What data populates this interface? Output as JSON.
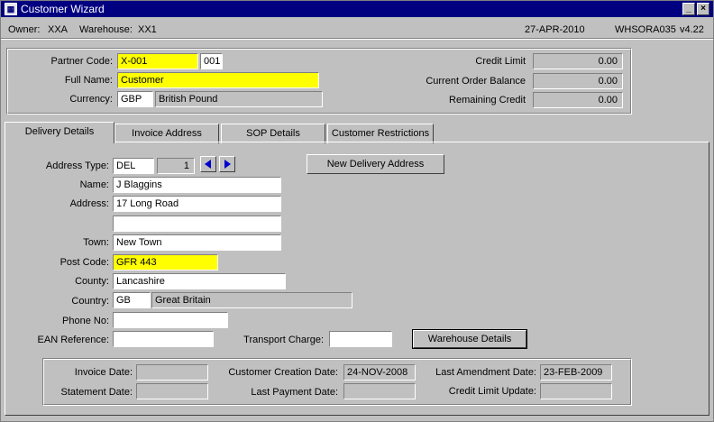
{
  "window": {
    "title": "Customer Wizard",
    "icon": "app-window-icon",
    "minimize_label": "_",
    "close_label": "×"
  },
  "status": {
    "owner_label": "Owner:",
    "owner": "XXA",
    "warehouse_label": "Warehouse:",
    "warehouse": "XX1",
    "date": "27-APR-2010",
    "form_id": "WHSORA035",
    "version": "v4.22"
  },
  "header": {
    "partner_code_label": "Partner Code:",
    "partner_code": "X-001",
    "partner_suffix": "001",
    "full_name_label": "Full Name:",
    "full_name": "Customer",
    "currency_label": "Currency:",
    "currency_code": "GBP",
    "currency_name": "British Pound",
    "credit_limit_label": "Credit Limit",
    "credit_limit": "0.00",
    "current_order_balance_label": "Current Order Balance",
    "current_order_balance": "0.00",
    "remaining_credit_label": "Remaining Credit",
    "remaining_credit": "0.00"
  },
  "tabs": [
    "Delivery Details",
    "Invoice Address",
    "SOP Details",
    "Customer Restrictions"
  ],
  "delivery": {
    "address_type_label": "Address Type:",
    "address_type": "DEL",
    "address_seq": "1",
    "new_delivery_address_button": "New Delivery Address",
    "name_label": "Name:",
    "name": "J Blaggins",
    "address_label": "Address:",
    "address_line1": "17 Long Road",
    "address_line2": "",
    "town_label": "Town:",
    "town": "New Town",
    "post_code_label": "Post Code:",
    "post_code": "GFR 443",
    "county_label": "County:",
    "county": "Lancashire",
    "country_label": "Country:",
    "country_code": "GB",
    "country_name": "Great Britain",
    "phone_label": "Phone No:",
    "phone": "",
    "ean_label": "EAN Reference:",
    "ean": "",
    "transport_charge_label": "Transport Charge:",
    "transport_charge": "",
    "warehouse_details_button": "Warehouse Details"
  },
  "dates": {
    "invoice_date_label": "Invoice Date:",
    "invoice_date": "",
    "statement_date_label": "Statement Date:",
    "statement_date": "",
    "customer_creation_date_label": "Customer Creation Date:",
    "customer_creation_date": "24-NOV-2008",
    "last_payment_date_label": "Last Payment Date:",
    "last_payment_date": "",
    "last_amendment_date_label": "Last Amendment Date:",
    "last_amendment_date": "23-FEB-2009",
    "credit_limit_update_label": "Credit Limit Update:",
    "credit_limit_update": ""
  },
  "colors": {
    "titlebar": "#000080",
    "highlight_field": "#ffff00",
    "arrow": "#0000cc"
  }
}
